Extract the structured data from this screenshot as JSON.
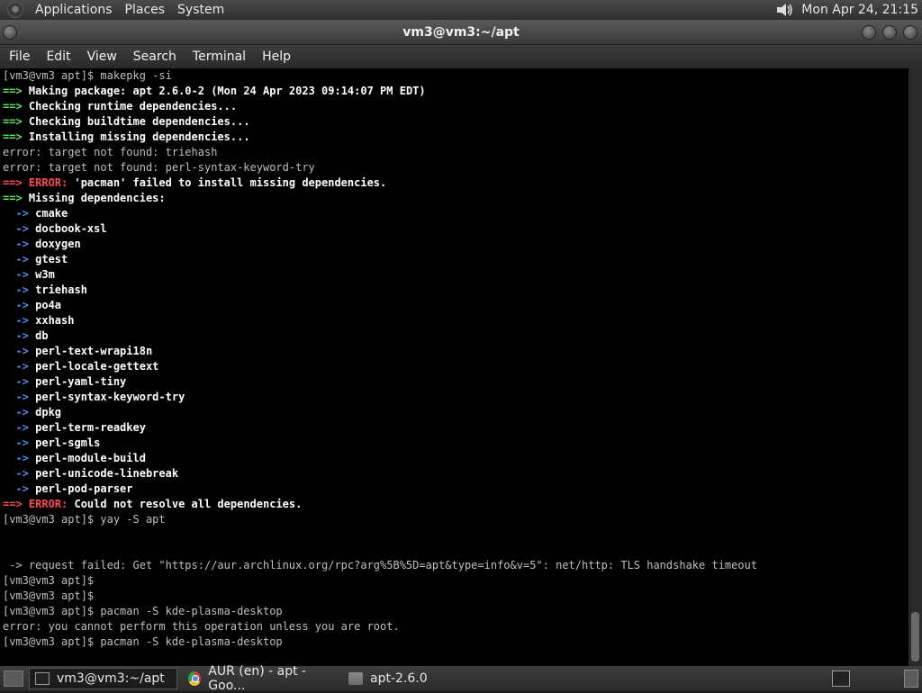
{
  "top_panel": {
    "menus": [
      "Applications",
      "Places",
      "System"
    ],
    "clock": "Mon Apr 24, 21:15"
  },
  "window": {
    "title": "vm3@vm3:~/apt"
  },
  "menubar": {
    "items": [
      "File",
      "Edit",
      "View",
      "Search",
      "Terminal",
      "Help"
    ]
  },
  "terminal": {
    "lines": [
      "[vm3@vm3 apt]$ makepkg -si",
      "==> Making package: apt 2.6.0-2 (Mon 24 Apr 2023 09:14:07 PM EDT)",
      "==> Checking runtime dependencies...",
      "==> Checking buildtime dependencies...",
      "==> Installing missing dependencies...",
      "error: target not found: triehash",
      "error: target not found: perl-syntax-keyword-try",
      "==> ERROR: 'pacman' failed to install missing dependencies.",
      "==> Missing dependencies:",
      "  -> cmake",
      "  -> docbook-xsl",
      "  -> doxygen",
      "  -> gtest",
      "  -> w3m",
      "  -> triehash",
      "  -> po4a",
      "  -> xxhash",
      "  -> db",
      "  -> perl-text-wrapi18n",
      "  -> perl-locale-gettext",
      "  -> perl-yaml-tiny",
      "  -> perl-syntax-keyword-try",
      "  -> dpkg",
      "  -> perl-term-readkey",
      "  -> perl-sgmls",
      "  -> perl-module-build",
      "  -> perl-unicode-linebreak",
      "  -> perl-pod-parser",
      "==> ERROR: Could not resolve all dependencies.",
      "[vm3@vm3 apt]$ yay -S apt",
      "",
      "",
      " -> request failed: Get \"https://aur.archlinux.org/rpc?arg%5B%5D=apt&type=info&v=5\": net/http: TLS handshake timeout",
      "[vm3@vm3 apt]$",
      "[vm3@vm3 apt]$",
      "[vm3@vm3 apt]$ pacman -S kde-plasma-desktop",
      "error: you cannot perform this operation unless you are root.",
      "[vm3@vm3 apt]$ pacman -S kde-plasma-desktop"
    ]
  },
  "taskbar": {
    "tasks": [
      {
        "label": "vm3@vm3:~/apt",
        "icon": "terminal-icon"
      },
      {
        "label": "AUR (en) - apt - Goo...",
        "icon": "chrome-icon"
      },
      {
        "label": "apt-2.6.0",
        "icon": "folder-icon"
      }
    ]
  },
  "colors": {
    "arrow_green": "#5ce65c",
    "error_red": "#ff4b4b",
    "dep_arrow_blue": "#4f8df5",
    "terminal_bg": "#000000"
  }
}
